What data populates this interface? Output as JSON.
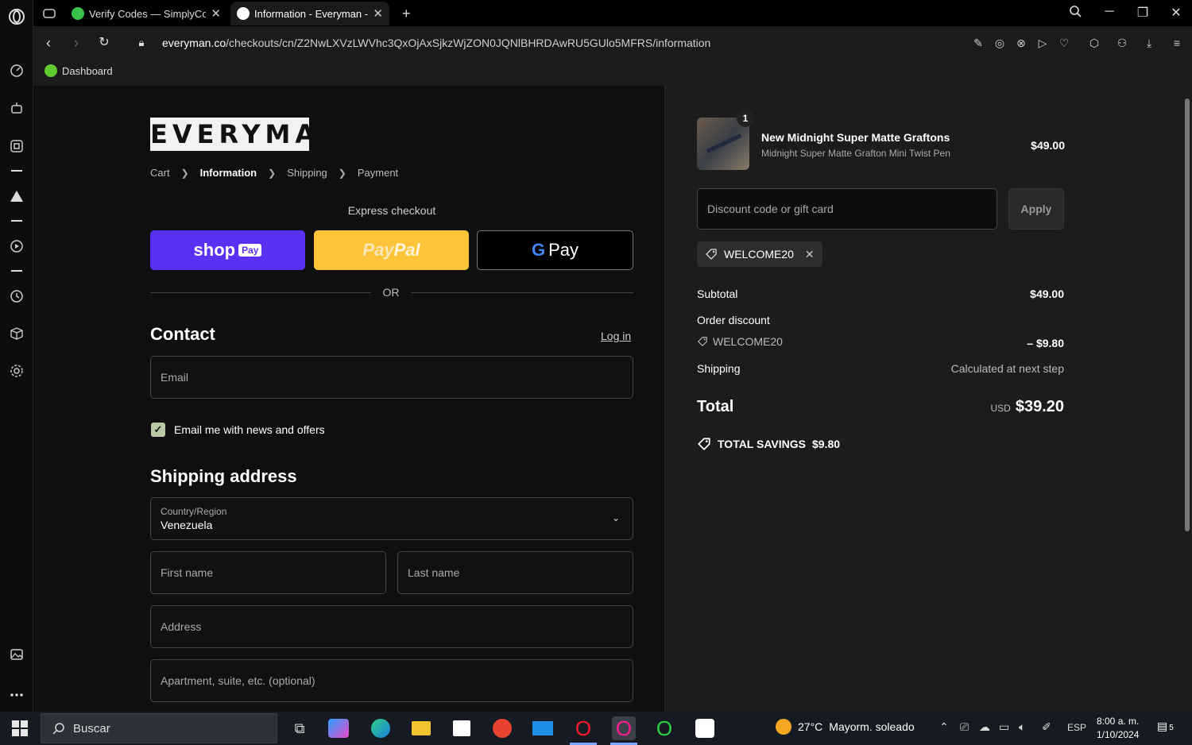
{
  "browser": {
    "tabs": [
      {
        "title": "Verify Codes — SimplyCodes",
        "active": false
      },
      {
        "title": "Information - Everyman - Checkout",
        "active": true
      }
    ],
    "new_tab": "+",
    "url_domain": "everyman.co",
    "url_path": "/checkouts/cn/Z2NwLXVzLWVhc3QxOjAxSjkzWjZON0JQNlBHRDAwRU5GUlo5MFRS/information",
    "bookmark": "Dashboard"
  },
  "checkout": {
    "logo": "EVERYMAN",
    "breadcrumbs": [
      "Cart",
      "Information",
      "Shipping",
      "Payment"
    ],
    "express_label": "Express checkout",
    "shop_pay": {
      "word": "shop",
      "badge": "Pay"
    },
    "paypal": {
      "a": "Pay",
      "b": "Pal"
    },
    "gpay": {
      "g": "G",
      "word": "Pay"
    },
    "or": "OR",
    "contact_heading": "Contact",
    "login_link": "Log in",
    "email_placeholder": "Email",
    "news_checkbox_label": "Email me with news and offers",
    "news_checked": true,
    "shipping_heading": "Shipping address",
    "country_label": "Country/Region",
    "country_value": "Venezuela",
    "first_name_placeholder": "First name",
    "last_name_placeholder": "Last name",
    "address_placeholder": "Address",
    "apartment_placeholder": "Apartment, suite, etc. (optional)"
  },
  "summary": {
    "quantity": "1",
    "product_name": "New Midnight Super Matte Graftons",
    "product_variant": "Midnight Super Matte Grafton Mini Twist Pen",
    "product_price": "$49.00",
    "discount_placeholder": "Discount code or gift card",
    "apply_label": "Apply",
    "applied_code": "WELCOME20",
    "subtotal_label": "Subtotal",
    "subtotal_value": "$49.00",
    "order_discount_label": "Order discount",
    "order_discount_code": "WELCOME20",
    "order_discount_value": "– $9.80",
    "shipping_label": "Shipping",
    "shipping_value": "Calculated at next step",
    "total_label": "Total",
    "total_currency": "USD",
    "total_value": "$39.20",
    "savings_label": "TOTAL SAVINGS",
    "savings_value": "$9.80"
  },
  "taskbar": {
    "search_placeholder": "Buscar",
    "weather_temp": "27°C",
    "weather_desc": "Mayorm. soleado",
    "language": "ESP",
    "time": "8:00 a. m.",
    "date": "1/10/2024",
    "notifications": "5"
  },
  "colors": {
    "shop_pay": "#5a31f4",
    "paypal": "#ffc439",
    "checkbox": "#b9c8a5",
    "panel": "#1c1c1c"
  }
}
